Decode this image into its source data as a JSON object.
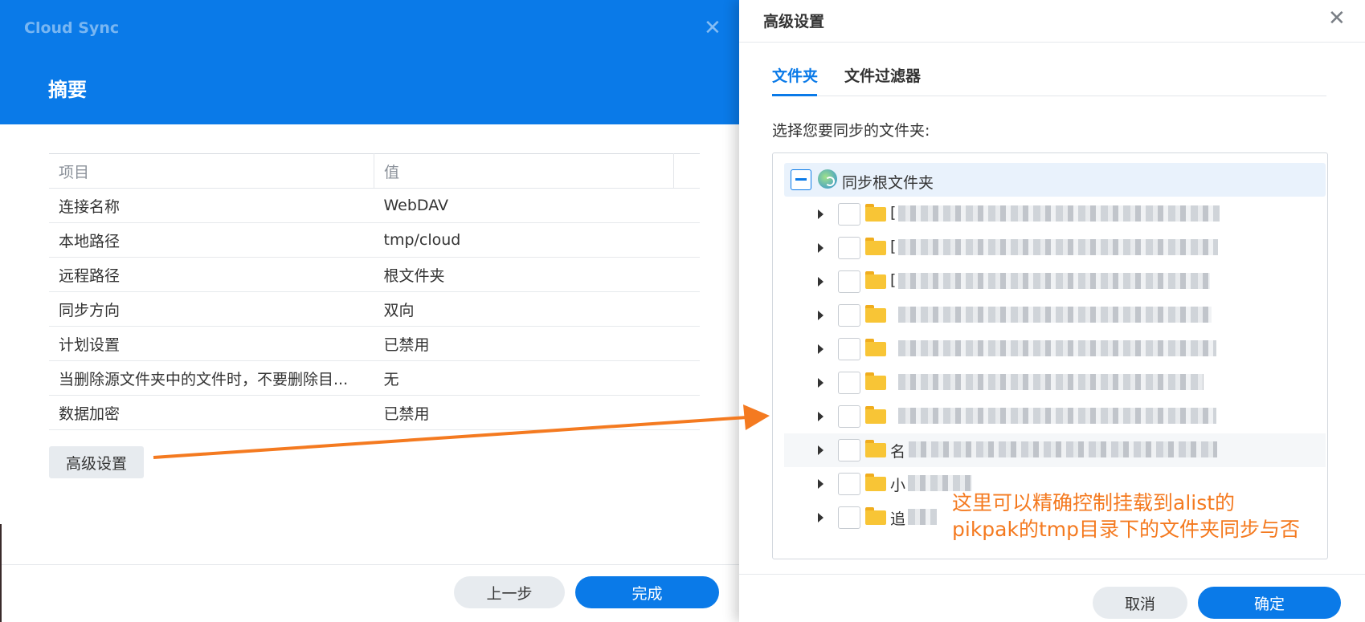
{
  "left_dialog": {
    "app_title": "Cloud Sync",
    "close_icon": "close-icon",
    "header_title": "摘要",
    "table_headers": [
      "项目",
      "值"
    ],
    "rows": [
      {
        "item": "连接名称",
        "value": "WebDAV"
      },
      {
        "item": "本地路径",
        "value": "tmp/cloud"
      },
      {
        "item": "远程路径",
        "value": "根文件夹"
      },
      {
        "item": "同步方向",
        "value": "双向"
      },
      {
        "item": "计划设置",
        "value": "已禁用"
      },
      {
        "item": "当删除源文件夹中的文件时，不要删除目...",
        "value": "无"
      },
      {
        "item": "数据加密",
        "value": "已禁用"
      }
    ],
    "advanced_button": "高级设置",
    "prev_button": "上一步",
    "finish_button": "完成",
    "accent_color": "#0a7ae8"
  },
  "right_dialog": {
    "title": "高级设置",
    "close_icon": "close-icon",
    "tabs": [
      "文件夹",
      "文件过滤器"
    ],
    "active_tab": "文件夹",
    "prompt": "选择您要同步的文件夹:",
    "root_label": "同步根文件夹",
    "folders": [
      {
        "prefix": "["
      },
      {
        "prefix": "["
      },
      {
        "prefix": "["
      },
      {
        "prefix": ""
      },
      {
        "prefix": ""
      },
      {
        "prefix": ""
      },
      {
        "prefix": ""
      },
      {
        "prefix": "名"
      },
      {
        "prefix": "小"
      },
      {
        "prefix": "追"
      }
    ],
    "cancel_button": "取消",
    "ok_button": "确定"
  },
  "annotation": {
    "line1": "这里可以精确控制挂载到alist的",
    "line2": "pikpak的tmp目录下的文件夹同步与否",
    "color": "#f47a20"
  }
}
